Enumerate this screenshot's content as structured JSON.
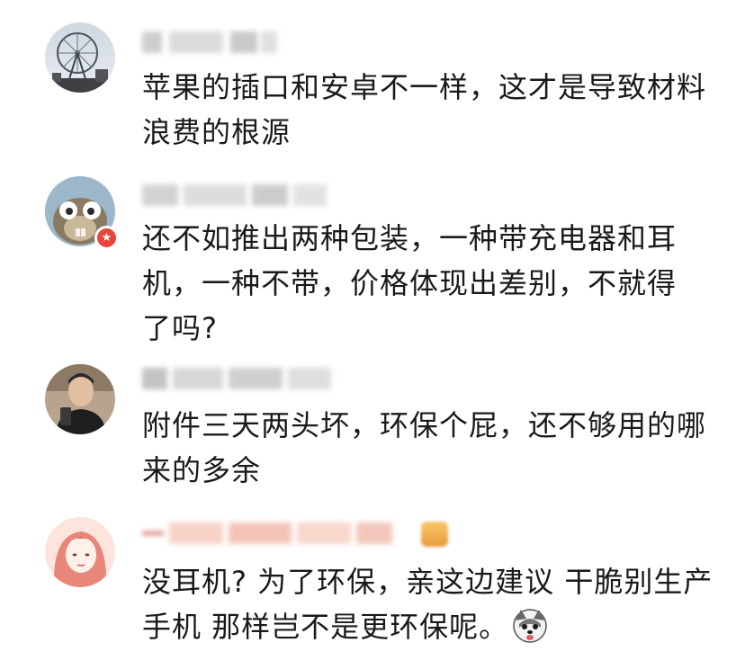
{
  "comments": [
    {
      "avatar": "ferris-wheel-photo",
      "username": "",
      "text": "苹果的插口和安卓不一样，这才是导致材料浪费的根源"
    },
    {
      "avatar": "cartoon-squirrel-photo",
      "username": "",
      "badge": "★",
      "text": "还不如推出两种包装，一种带充电器和耳机，一种不带，价格体现出差别，不就得了吗?"
    },
    {
      "avatar": "young-man-photo",
      "username": "",
      "text": "附件三天两头坏，环保个屁，还不够用的哪来的多余"
    },
    {
      "avatar": "illustrated-girl-photo",
      "username": "",
      "text": "没耳机? 为了环保，亲这边建议 干脆别生产手机 那样岂不是更环保呢。",
      "emoji": "husky-dog-emoji"
    }
  ],
  "colors": {
    "text": "#1a1a1a",
    "badge": "#e8453c",
    "blurred_name": "#c9c9c9",
    "blurred_name_pink": "#f2b8a8"
  }
}
